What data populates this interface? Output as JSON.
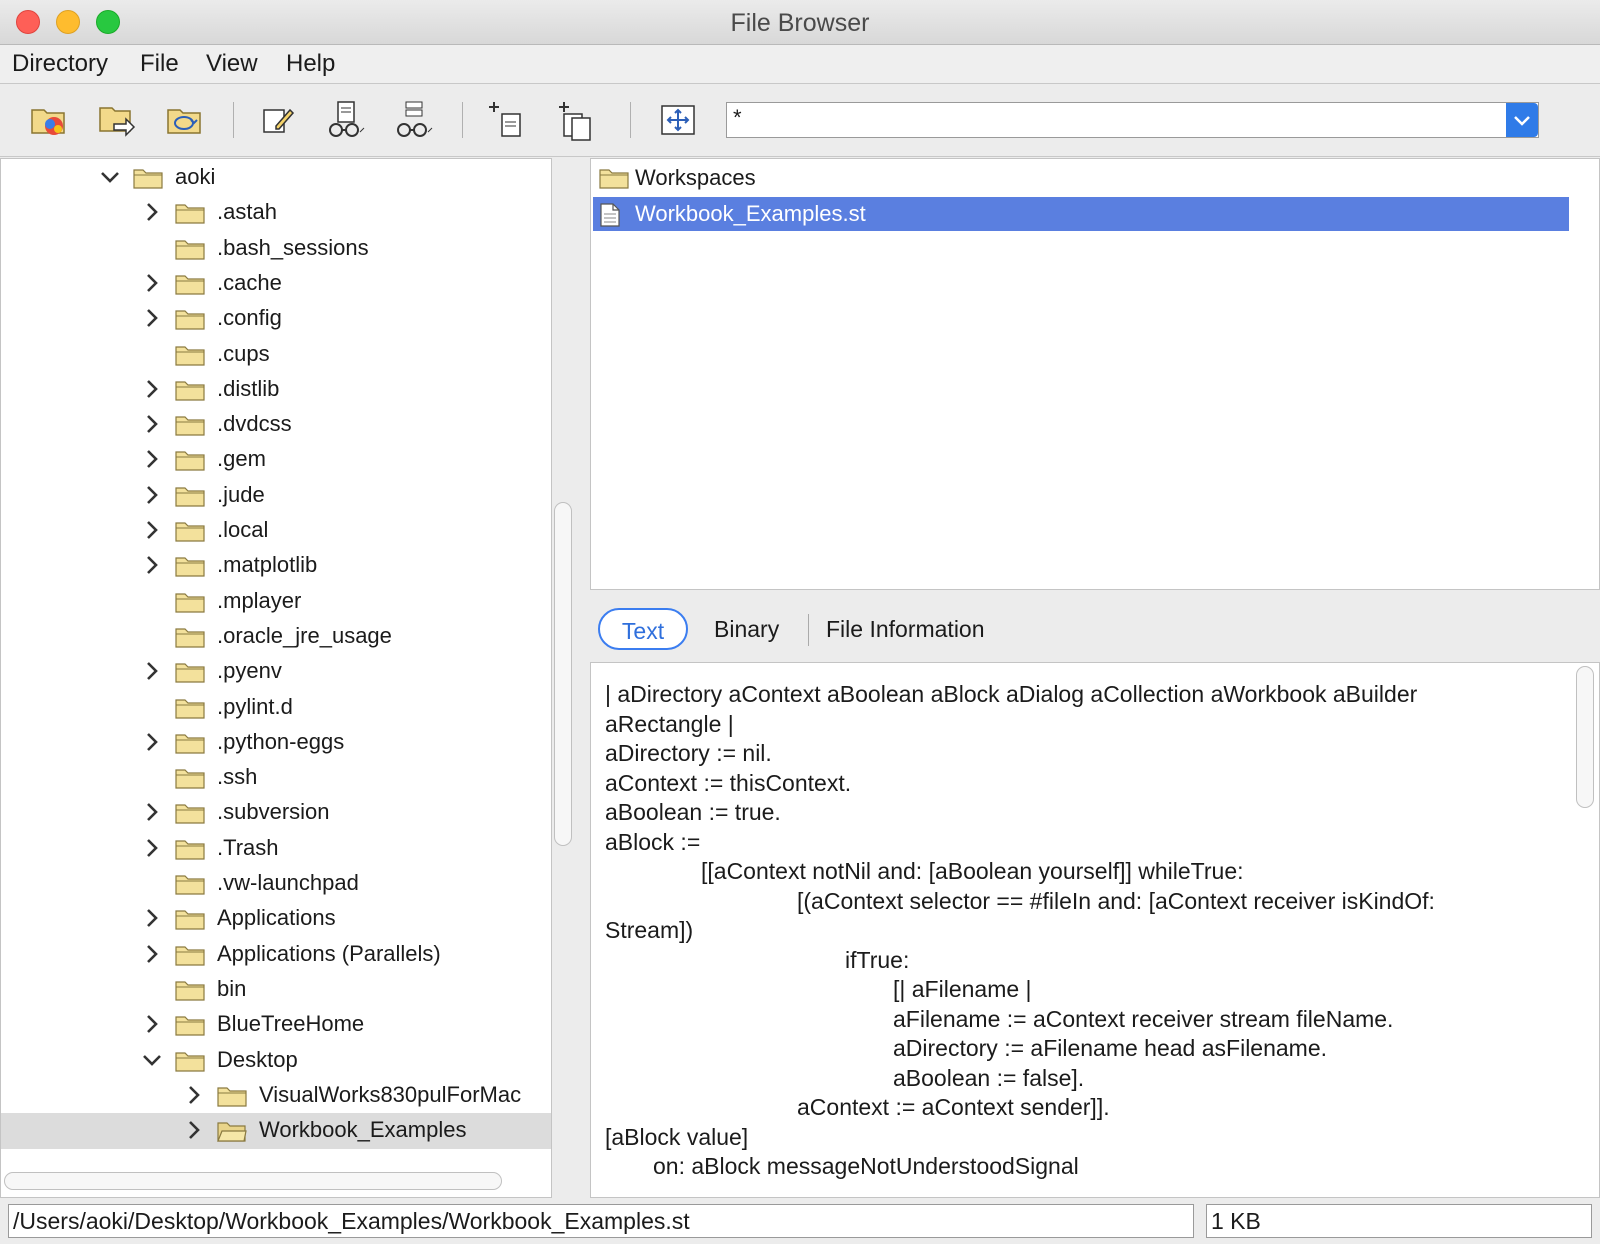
{
  "window": {
    "title": "File Browser"
  },
  "menubar": {
    "items": [
      "Directory",
      "File",
      "View",
      "Help"
    ]
  },
  "toolbar": {
    "filter_value": "*",
    "buttons": [
      "new-directory-icon",
      "go-to-directory-icon",
      "refresh-icon",
      "edit-icon",
      "find-file-icon",
      "find-text-icon",
      "new-file-icon",
      "new-directory-copy-icon",
      "fit-view-icon"
    ]
  },
  "tree": {
    "items": [
      {
        "label": "aoki",
        "level": 0,
        "expander": "expanded"
      },
      {
        "label": ".astah",
        "level": 1,
        "expander": "collapsed"
      },
      {
        "label": ".bash_sessions",
        "level": 1,
        "expander": "none"
      },
      {
        "label": ".cache",
        "level": 1,
        "expander": "collapsed"
      },
      {
        "label": ".config",
        "level": 1,
        "expander": "collapsed"
      },
      {
        "label": ".cups",
        "level": 1,
        "expander": "none"
      },
      {
        "label": ".distlib",
        "level": 1,
        "expander": "collapsed"
      },
      {
        "label": ".dvdcss",
        "level": 1,
        "expander": "collapsed"
      },
      {
        "label": ".gem",
        "level": 1,
        "expander": "collapsed"
      },
      {
        "label": ".jude",
        "level": 1,
        "expander": "collapsed"
      },
      {
        "label": ".local",
        "level": 1,
        "expander": "collapsed"
      },
      {
        "label": ".matplotlib",
        "level": 1,
        "expander": "collapsed"
      },
      {
        "label": ".mplayer",
        "level": 1,
        "expander": "none"
      },
      {
        "label": ".oracle_jre_usage",
        "level": 1,
        "expander": "none"
      },
      {
        "label": ".pyenv",
        "level": 1,
        "expander": "collapsed"
      },
      {
        "label": ".pylint.d",
        "level": 1,
        "expander": "none"
      },
      {
        "label": ".python-eggs",
        "level": 1,
        "expander": "collapsed"
      },
      {
        "label": ".ssh",
        "level": 1,
        "expander": "none"
      },
      {
        "label": ".subversion",
        "level": 1,
        "expander": "collapsed"
      },
      {
        "label": ".Trash",
        "level": 1,
        "expander": "collapsed"
      },
      {
        "label": ".vw-launchpad",
        "level": 1,
        "expander": "none"
      },
      {
        "label": "Applications",
        "level": 1,
        "expander": "collapsed"
      },
      {
        "label": "Applications (Parallels)",
        "level": 1,
        "expander": "collapsed"
      },
      {
        "label": "bin",
        "level": 1,
        "expander": "none"
      },
      {
        "label": "BlueTreeHome",
        "level": 1,
        "expander": "collapsed"
      },
      {
        "label": "Desktop",
        "level": 1,
        "expander": "expanded"
      },
      {
        "label": "VisualWorks830pulForMac",
        "level": 2,
        "expander": "collapsed"
      },
      {
        "label": "Workbook_Examples",
        "level": 2,
        "expander": "collapsed",
        "selected": true,
        "open": true
      }
    ]
  },
  "files": [
    {
      "label": "Workspaces",
      "icon": "folder-icon",
      "selected": false
    },
    {
      "label": "Workbook_Examples.st",
      "icon": "document-icon",
      "selected": true
    }
  ],
  "tabs": [
    {
      "label": "Text",
      "active": true
    },
    {
      "label": "Binary",
      "active": false
    },
    {
      "label": "File Information",
      "active": false
    }
  ],
  "content": {
    "lines": [
      {
        "text": "| aDirectory aContext aBoolean aBlock aDialog aCollection aWorkbook aBuilder",
        "indent": 0
      },
      {
        "text": "aRectangle |",
        "indent": 0
      },
      {
        "text": "aDirectory := nil.",
        "indent": 0
      },
      {
        "text": "aContext := thisContext.",
        "indent": 0
      },
      {
        "text": "aBoolean := true.",
        "indent": 0
      },
      {
        "text": "aBlock :=",
        "indent": 0
      },
      {
        "text": "[[aContext notNil and: [aBoolean yourself]] whileTrue:",
        "indent": 2
      },
      {
        "text": "[(aContext selector == #fileIn and: [aContext receiver isKindOf:",
        "indent": 4
      },
      {
        "text": "Stream])",
        "indent": 0
      },
      {
        "text": "ifTrue:",
        "indent": 5
      },
      {
        "text": "[| aFilename |",
        "indent": 6
      },
      {
        "text": "aFilename := aContext receiver stream fileName.",
        "indent": 6
      },
      {
        "text": "aDirectory := aFilename head asFilename.",
        "indent": 6
      },
      {
        "text": "aBoolean := false].",
        "indent": 6
      },
      {
        "text": "aContext := aContext sender]].",
        "indent": 4
      },
      {
        "text": "[aBlock value]",
        "indent": 0
      },
      {
        "text": "on: aBlock messageNotUnderstoodSignal",
        "indent": 1
      }
    ]
  },
  "status": {
    "path": "/Users/aoki/Desktop/Workbook_Examples/Workbook_Examples.st",
    "size": "1 KB"
  }
}
